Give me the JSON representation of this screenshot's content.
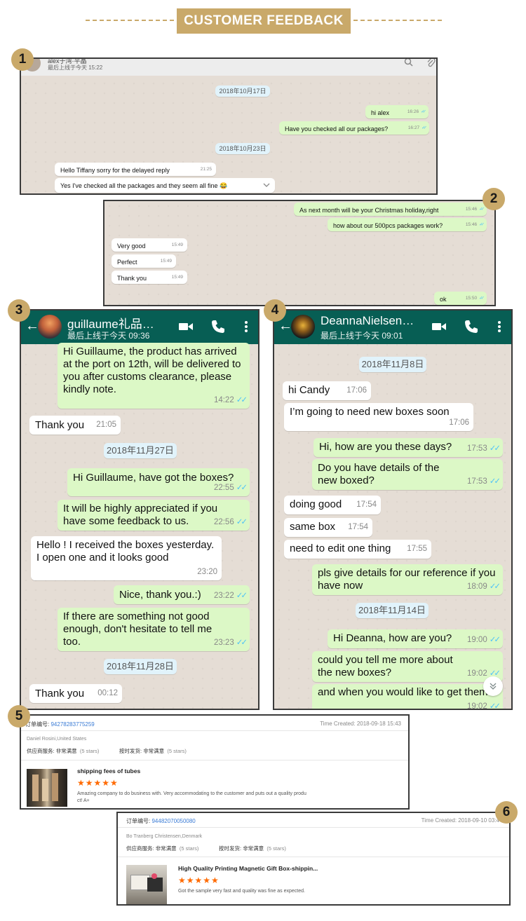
{
  "header": {
    "title": "CUSTOMER FEEDBACK"
  },
  "badges": [
    "1",
    "2",
    "3",
    "4",
    "5",
    "6"
  ],
  "panel1": {
    "contact": "alex于湾·平晶",
    "status": "最后上线于今天 15:22",
    "icons": [
      "search-icon",
      "attach-icon"
    ],
    "date1": "2018年10月17日",
    "msg1": {
      "text": "hi  alex",
      "time": "16:26"
    },
    "msg2": {
      "text": "Have you checked all our packages?",
      "time": "16:27"
    },
    "date2": "2018年10月23日",
    "msg3": {
      "text": "Hello Tiffany sorry for the delayed reply",
      "time": "21:25"
    },
    "msg4": {
      "text": "Yes I've checked all the packages and they seem all fine 😂"
    }
  },
  "panel2": {
    "msg1": {
      "text": "As next month will be your Christmas holiday,right",
      "time": "15:46"
    },
    "msg2": {
      "text": "how about our 500pcs packages work?",
      "time": "15:46"
    },
    "msg3": {
      "text": "Very good",
      "time": "15:49"
    },
    "msg4": {
      "text": "Perfect",
      "time": "15:49"
    },
    "msg5": {
      "text": "Thank you",
      "time": "15:49"
    },
    "msg6": {
      "text": "ok",
      "time": "15:50"
    }
  },
  "panel3": {
    "contact": "guillaume礼品…",
    "status": "最后上线于今天 09:36",
    "msg1": {
      "text": "Hi Guillaume, the product has arrived at the port on 12th, will be delivered to you after customs clearance, please kindly note.",
      "time": "14:22"
    },
    "msg2": {
      "text": "Thank you",
      "time": "21:05"
    },
    "date1": "2018年11月27日",
    "msg3": {
      "text": "Hi Guillaume, have got the boxes?",
      "time": "22:55"
    },
    "msg4": {
      "text": "It will be highly appreciated if you have some feedback to us.",
      "time": "22:56"
    },
    "msg5": {
      "text": "Hello ! I received the boxes yesterday. I open one and it looks good",
      "time": "23:20"
    },
    "msg6": {
      "text": "Nice, thank you.:)",
      "time": "23:22"
    },
    "msg7": {
      "text": "If there are something not good enough, don't hesitate to tell me too.",
      "time": "23:23"
    },
    "date2": "2018年11月28日",
    "msg8": {
      "text": "Thank you",
      "time": "00:12"
    }
  },
  "panel4": {
    "contact": "DeannaNielsen…",
    "status": "最后上线于今天 09:01",
    "date1": "2018年11月8日",
    "msg1": {
      "text": "hi Candy",
      "time": "17:06"
    },
    "msg2": {
      "text": "I’m going to need new boxes soon",
      "time": "17:06"
    },
    "msg3": {
      "text": "Hi, how are you these days?",
      "time": "17:53"
    },
    "msg4": {
      "text": "Do you have details of the new boxed?",
      "time": "17:53"
    },
    "msg5": {
      "text": "doing good",
      "time": "17:54"
    },
    "msg6": {
      "text": "same box",
      "time": "17:54"
    },
    "msg7": {
      "text": "need to edit one thing",
      "time": "17:55"
    },
    "msg8": {
      "text": "pls give details for our reference if you have now",
      "time": "18:09"
    },
    "date2": "2018年11月14日",
    "msg9": {
      "text": "Hi Deanna, how are you?",
      "time": "19:00"
    },
    "msg10": {
      "text": "could you tell me more about the new boxes?",
      "time": "19:02"
    },
    "msg11": {
      "text": "and when you would like to get them?",
      "time": "19:02"
    }
  },
  "order5": {
    "order_label": "订单编号:",
    "order_no": "94278283775259",
    "time_created": "Time Created: 2018-09-18 15:43",
    "buyer": "Daniel Rosini,United States",
    "service_label": "供应商服务:",
    "service_value": "非常满意",
    "service_stars": "(5 stars)",
    "ship_label": "按时发货:",
    "ship_value": "非常满意",
    "ship_stars": "(5 stars)",
    "product": "shipping fees of tubes",
    "rating": "★★★★★",
    "comment_1": "Amazing company to do business with.  Very accommodating to the customer and puts out a quality produ",
    "comment_2": "ct!  A+"
  },
  "order6": {
    "order_label": "订单编号:",
    "order_no": "94482070050080",
    "time_created": "Time Created: 2018-09-10 03:4",
    "buyer": "Bo Tranberg Christensen,Denmark",
    "service_label": "供应商服务:",
    "service_value": "非常满意",
    "service_stars": "(5 stars)",
    "ship_label": "按时发货:",
    "ship_value": "非常满意",
    "ship_stars": "(5 stars)",
    "product": "High Quality Printing Magnetic Gift Box-shippin...",
    "rating": "★★★★★",
    "comment": "Got the sample very fast and quality was fine as expected."
  }
}
